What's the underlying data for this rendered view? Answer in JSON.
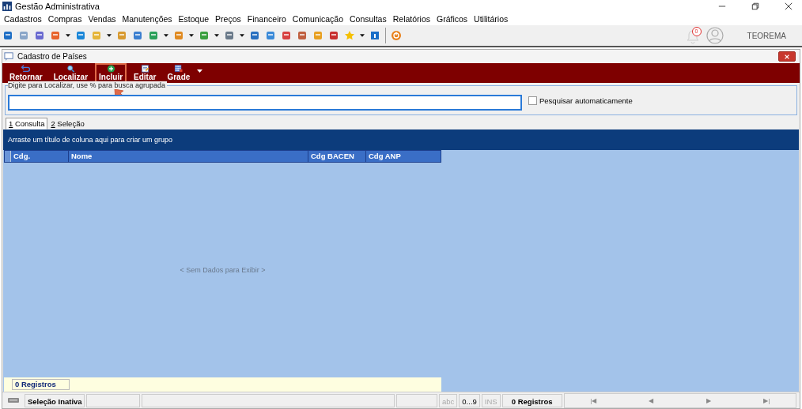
{
  "window": {
    "title": "Gestão Administrativa"
  },
  "menu": [
    "Cadastros",
    "Compras",
    "Vendas",
    "Manutenções",
    "Estoque",
    "Preços",
    "Financeiro",
    "Comunicação",
    "Consultas",
    "Relatórios",
    "Gráficos",
    "Utilitários"
  ],
  "notifications": {
    "count": "0"
  },
  "user": {
    "name": "TEOREMA"
  },
  "form": {
    "title": "Cadastro de Países",
    "actions": [
      {
        "label": "Retornar",
        "kind": "back",
        "highlighted": false
      },
      {
        "label": "Localizar",
        "kind": "search",
        "highlighted": false
      },
      {
        "label": "Incluir",
        "kind": "add",
        "highlighted": true
      },
      {
        "label": "Editar",
        "kind": "edit",
        "highlighted": false
      },
      {
        "label": "Grade",
        "kind": "grid",
        "highlighted": false
      }
    ],
    "search": {
      "label": "Digite para Localizar, use % para busca agrupada",
      "auto_search": {
        "label": "Pesquisar automaticamente",
        "checked": false
      }
    },
    "tabs": [
      {
        "label": "1 Consulta",
        "selected": true
      },
      {
        "label": "2 Seleção",
        "selected": false
      }
    ],
    "group_panel": "Arraste um título de coluna aqui para criar um grupo",
    "table": {
      "columns": [
        "Cdg.",
        "Nome",
        "Cdg BACEN",
        "Cdg ANP"
      ],
      "empty_text": "< Sem Dados para Exibir >",
      "footer": "0 Registros"
    }
  },
  "status_bar": {
    "selection": "Seleção Inativa",
    "abc": "abc",
    "digits": "0...9",
    "ins": "INS",
    "records": "0 Registros",
    "nav": [
      "|◀",
      "◀",
      "▶",
      "▶|"
    ]
  }
}
